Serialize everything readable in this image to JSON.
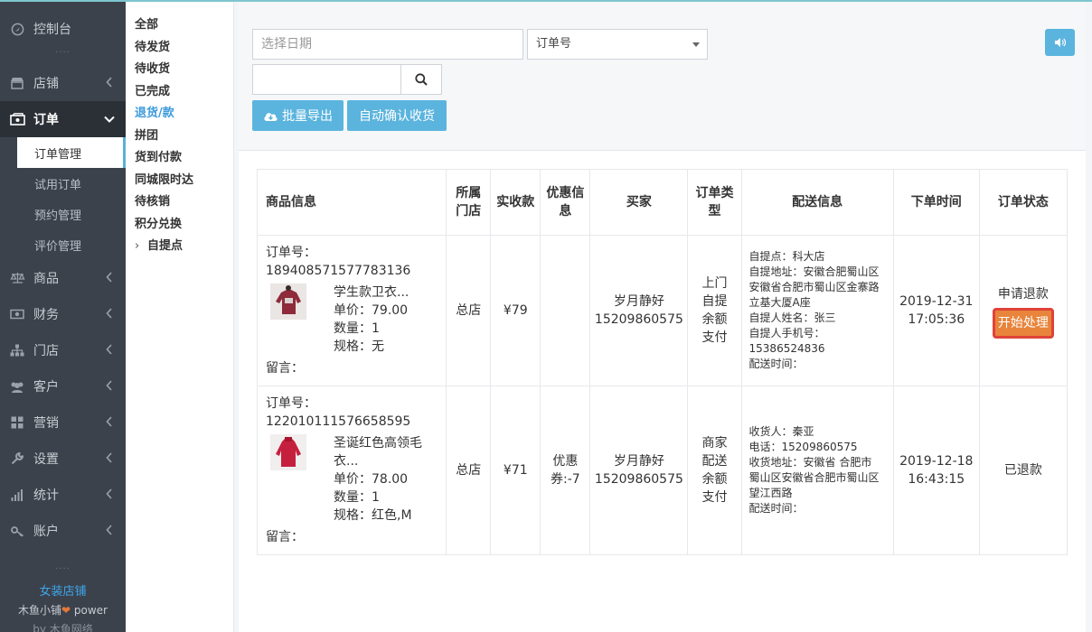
{
  "sidebar": {
    "items": [
      {
        "label": "控制台",
        "icon": "dashboard-icon"
      },
      {
        "label": "店铺",
        "icon": "shop-icon"
      },
      {
        "label": "订单",
        "icon": "order-icon"
      },
      {
        "label": "商品",
        "icon": "scale-icon"
      },
      {
        "label": "财务",
        "icon": "money-icon"
      },
      {
        "label": "门店",
        "icon": "sitemap-icon"
      },
      {
        "label": "客户",
        "icon": "users-icon"
      },
      {
        "label": "营销",
        "icon": "grid-icon"
      },
      {
        "label": "设置",
        "icon": "wrench-icon"
      },
      {
        "label": "统计",
        "icon": "bar-chart-icon"
      },
      {
        "label": "账户",
        "icon": "key-icon"
      }
    ],
    "sub_items": [
      "订单管理",
      "试用订单",
      "预约管理",
      "评价管理"
    ],
    "store_name": "女装店铺",
    "power_prefix": "木鱼小铺",
    "power_suffix": " power",
    "by_line": "by 木鱼网络"
  },
  "subnav": {
    "items": [
      "全部",
      "待发货",
      "待收货",
      "已完成",
      "退货/款",
      "拼团",
      "货到付款",
      "同城限时达",
      "待核销",
      "积分兑换"
    ],
    "pickup": "自提点",
    "caret": "›"
  },
  "filters": {
    "date_placeholder": "选择日期",
    "select_value": "订单号",
    "search_value": "",
    "export_label": "批量导出",
    "auto_confirm_label": "自动确认收货"
  },
  "table": {
    "headers": {
      "goods": "商品信息",
      "store": "所属门店",
      "paid": "实收款",
      "discount": "优惠信息",
      "buyer": "买家",
      "order_type": "订单类型",
      "delivery": "配送信息",
      "order_time": "下单时间",
      "status": "订单状态"
    },
    "rows": [
      {
        "order_no_label": "订单号：",
        "order_no": "189408571577783136",
        "product_name": "学生款卫衣...",
        "unit_price": "单价：79.00",
        "qty": "数量：1",
        "spec": "规格：无",
        "message": "留言：",
        "store": "总店",
        "paid": "¥79",
        "discount": "",
        "buyer_name": "岁月静好",
        "buyer_phone": "15209860575",
        "order_type": [
          "上门",
          "自提",
          "余额",
          "支付"
        ],
        "delivery": [
          "自提点：科大店",
          "自提地址：安徽合肥蜀山区安徽省合肥市蜀山区金寨路 立基大厦A座",
          "自提人姓名：张三",
          "自提人手机号：15386524836",
          "配送时间："
        ],
        "date": "2019-12-31",
        "time": "17:05:36",
        "status": "申请退款",
        "action": "开始处理"
      },
      {
        "order_no_label": "订单号：",
        "order_no": "122010111576658595",
        "product_name": "圣诞红色高领毛衣...",
        "unit_price": "单价：78.00",
        "qty": "数量：1",
        "spec": "规格：红色,M",
        "message": "留言：",
        "store": "总店",
        "paid": "¥71",
        "discount": "优惠券:-7",
        "buyer_name": "岁月静好",
        "buyer_phone": "15209860575",
        "order_type": [
          "商家",
          "配送",
          "余额",
          "支付"
        ],
        "delivery": [
          "收货人：秦亚",
          "电话：15209860575",
          "收货地址：安徽省 合肥市 蜀山区安徽省合肥市蜀山区望江西路",
          "配送时间："
        ],
        "date": "2019-12-18",
        "time": "16:43:15",
        "status": "已退款",
        "action": ""
      }
    ]
  },
  "colors": {
    "sidebar_bg": "#3c424c",
    "accent_blue": "#5bb4de",
    "action_orange": "#e8843b",
    "highlight_red": "#e0423a"
  }
}
